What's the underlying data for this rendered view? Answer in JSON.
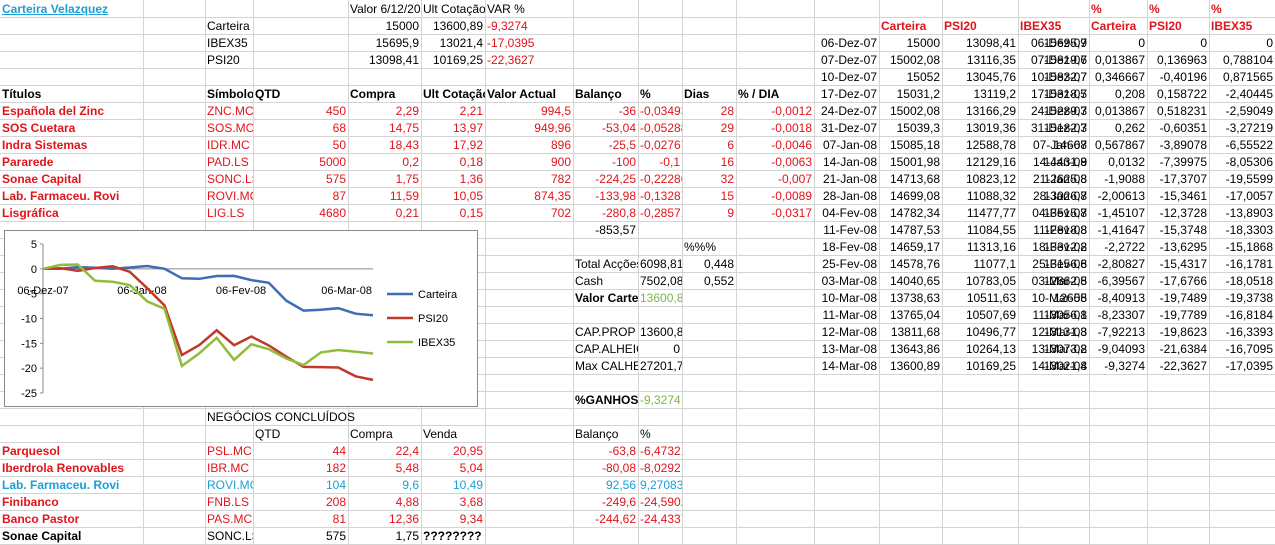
{
  "colors": {
    "red": "#e0141b",
    "blue": "#1b9fd6",
    "green": "#7ab648",
    "grid": "#d4d4d4",
    "carteira_line": "#3e6db5",
    "psi20_line": "#c0392b",
    "ibex35_line": "#8fbc3b"
  },
  "title_link": "Carteira Velazquez",
  "summary": {
    "header": [
      "Valor 6/12/2007",
      "Ult Cotação",
      "VAR %"
    ],
    "rows": [
      {
        "label": "Carteira",
        "valor": "15000",
        "ult": "13600,89",
        "var": "-9,3274"
      },
      {
        "label": "IBEX35",
        "valor": "15695,9",
        "ult": "13021,4",
        "var": "-17,0395"
      },
      {
        "label": "PSI20",
        "valor": "13098,41",
        "ult": "10169,25",
        "var": "-22,3627"
      }
    ]
  },
  "holdings": {
    "headers": [
      "Títulos",
      "Símbolo",
      "QTD",
      "Compra",
      "Ult Cotação",
      "Valor Actual",
      "Balanço",
      "%",
      "Dias",
      "% / DIA"
    ],
    "rows": [
      [
        "Española del Zinc",
        "ZNC.MC",
        "450",
        "2,29",
        "2,21",
        "994,5",
        "-36",
        "-0,03493",
        "28",
        "-0,0012"
      ],
      [
        "SOS Cuetara",
        "SOS.MC",
        "68",
        "14,75",
        "13,97",
        "949,96",
        "-53,04",
        "-0,05288",
        "29",
        "-0,0018"
      ],
      [
        "Indra Sistemas",
        "IDR.MC",
        "50",
        "18,43",
        "17,92",
        "896",
        "-25,5",
        "-0,02767",
        "6",
        "-0,0046"
      ],
      [
        "Pararede",
        "PAD.LS",
        "5000",
        "0,2",
        "0,18",
        "900",
        "-100",
        "-0,1",
        "16",
        "-0,0063"
      ],
      [
        "Sonae Capital",
        "SONC.LS",
        "575",
        "1,75",
        "1,36",
        "782",
        "-224,25",
        "-0,22286",
        "32",
        "-0,007"
      ],
      [
        "Lab. Farmaceu. Rovi",
        "ROVI.MC",
        "87",
        "11,59",
        "10,05",
        "874,35",
        "-133,98",
        "-0,13287",
        "15",
        "-0,0089"
      ],
      [
        "Lisgráfica",
        "LIG.LS",
        "4680",
        "0,21",
        "0,15",
        "702",
        "-280,8",
        "-0,28571",
        "9",
        "-0,0317"
      ]
    ],
    "total_balanco": "-853,57"
  },
  "totals": {
    "pct_header": "%%%",
    "rows": [
      {
        "label": "Total Acções",
        "value": "6098,81",
        "pct": "0,448",
        "bold": false,
        "green": false
      },
      {
        "label": "Cash",
        "value": "7502,08",
        "pct": "0,552",
        "bold": false,
        "green": false
      },
      {
        "label": "Valor Carteira",
        "value": "13600,89",
        "pct": "",
        "bold": true,
        "green": true
      },
      {
        "label": "CAP.PROP",
        "value": "13600,89",
        "pct": "",
        "bold": false,
        "green": false
      },
      {
        "label": "CAP.ALHEIO",
        "value": "0",
        "pct": "",
        "bold": false,
        "green": false
      },
      {
        "label": "Max CALHEIO",
        "value": "27201,78",
        "pct": "",
        "bold": false,
        "green": false
      },
      {
        "label": "%GANHOS",
        "value": "-9,3274",
        "pct": "",
        "bold": true,
        "green": true
      }
    ]
  },
  "closed": {
    "title": "NEGÓCIOS CONCLUÍDOS",
    "headers": [
      "QTD",
      "Compra",
      "Venda",
      "Balanço",
      "%"
    ],
    "rows": [
      {
        "cells": [
          "Parquesol",
          "PSL.MC",
          "44",
          "22,4",
          "20,95",
          "-63,8",
          "-6,47321"
        ],
        "color": "red"
      },
      {
        "cells": [
          "Iberdrola Renovables",
          "IBR.MC",
          "182",
          "5,48",
          "5,04",
          "-80,08",
          "-8,0292"
        ],
        "color": "red"
      },
      {
        "cells": [
          "Lab. Farmaceu. Rovi",
          "ROVI.MC",
          "104",
          "9,6",
          "10,49",
          "92,56",
          "9,270833"
        ],
        "color": "blue"
      },
      {
        "cells": [
          "Finibanco",
          "FNB.LS",
          "208",
          "4,88",
          "3,68",
          "-249,6",
          "-24,5902"
        ],
        "color": "red"
      },
      {
        "cells": [
          "Banco Pastor",
          "PAS.MC",
          "81",
          "12,36",
          "9,34",
          "-244,62",
          "-24,4337"
        ],
        "color": "red"
      },
      {
        "cells": [
          "Sonae Capital",
          "SONC.LS",
          "575",
          "1,75",
          "????????",
          "",
          ""
        ],
        "color": "black"
      }
    ]
  },
  "history": {
    "headers": [
      "Carteira",
      "PSI20",
      "IBEX35"
    ],
    "rows": [
      [
        "06-Dez-07",
        "15000",
        "13098,41",
        "15695,9"
      ],
      [
        "07-Dez-07",
        "15002,08",
        "13116,35",
        "15819,6"
      ],
      [
        "10-Dez-07",
        "15052",
        "13045,76",
        "15832,7"
      ],
      [
        "17-Dez-07",
        "15031,2",
        "13119,2",
        "15318,5"
      ],
      [
        "24-Dez-07",
        "15002,08",
        "13166,29",
        "15289,3"
      ],
      [
        "31-Dez-07",
        "15039,3",
        "13019,36",
        "15182,3"
      ],
      [
        "07-Jan-08",
        "15085,18",
        "12588,78",
        "14667"
      ],
      [
        "14-Jan-08",
        "15001,98",
        "12129,16",
        "14431,9"
      ],
      [
        "21-Jan-08",
        "14713,68",
        "10823,12",
        "12625,8"
      ],
      [
        "28-Jan-08",
        "14699,08",
        "11088,32",
        "13026,7"
      ],
      [
        "04-Fev-08",
        "14782,34",
        "11477,77",
        "13515,7"
      ],
      [
        "11-Fev-08",
        "14787,53",
        "11084,55",
        "12818,8"
      ],
      [
        "18-Fev-08",
        "14659,17",
        "11313,16",
        "13312,2"
      ],
      [
        "25-Fev-08",
        "14578,76",
        "11077,1",
        "13156,6"
      ],
      [
        "03-Mar-08",
        "14040,65",
        "10783,05",
        "12862,5"
      ],
      [
        "10-Mar-08",
        "13738,63",
        "10511,63",
        "12655"
      ],
      [
        "11-Mar-08",
        "13765,04",
        "10507,69",
        "13056,1"
      ],
      [
        "12-Mar-08",
        "13811,68",
        "10496,77",
        "13131,3"
      ],
      [
        "13-Mar-08",
        "13643,86",
        "10264,13",
        "13073,2"
      ],
      [
        "14-Mar-08",
        "13600,89",
        "10169,25",
        "13021,4"
      ]
    ]
  },
  "pct_history": {
    "headers_top": [
      "%",
      "%",
      "%"
    ],
    "headers": [
      "Carteira",
      "PSI20",
      "IBEX35"
    ],
    "rows": [
      [
        "06-Dez-07",
        "0",
        "0",
        "0"
      ],
      [
        "07-Dez-07",
        "0,013867",
        "0,136963",
        "0,788104"
      ],
      [
        "10-Dez-07",
        "0,346667",
        "-0,40196",
        "0,871565"
      ],
      [
        "17-Dez-07",
        "0,208",
        "0,158722",
        "-2,40445"
      ],
      [
        "24-Dez-07",
        "0,013867",
        "0,518231",
        "-2,59049"
      ],
      [
        "31-Dez-07",
        "0,262",
        "-0,60351",
        "-3,27219"
      ],
      [
        "07-Jan-08",
        "0,567867",
        "-3,89078",
        "-6,55522"
      ],
      [
        "14-Jan-08",
        "0,0132",
        "-7,39975",
        "-8,05306"
      ],
      [
        "21-Jan-08",
        "-1,9088",
        "-17,3707",
        "-19,5599"
      ],
      [
        "28-Jan-08",
        "-2,00613",
        "-15,3461",
        "-17,0057"
      ],
      [
        "04-Fev-08",
        "-1,45107",
        "-12,3728",
        "-13,8903"
      ],
      [
        "11-Fev-08",
        "-1,41647",
        "-15,3748",
        "-18,3303"
      ],
      [
        "18-Fev-08",
        "-2,2722",
        "-13,6295",
        "-15,1868"
      ],
      [
        "25-Fev-08",
        "-2,80827",
        "-15,4317",
        "-16,1781"
      ],
      [
        "03-Mar-08",
        "-6,39567",
        "-17,6766",
        "-18,0518"
      ],
      [
        "10-Mar-08",
        "-8,40913",
        "-19,7489",
        "-19,3738"
      ],
      [
        "11-Mar-08",
        "-8,23307",
        "-19,7789",
        "-16,8184"
      ],
      [
        "12-Mar-08",
        "-7,92213",
        "-19,8623",
        "-16,3393"
      ],
      [
        "13-Mar-08",
        "-9,04093",
        "-21,6384",
        "-16,7095"
      ],
      [
        "14-Mar-08",
        "-9,3274",
        "-22,3627",
        "-17,0395"
      ]
    ]
  },
  "chart_data": {
    "type": "line",
    "x": [
      "06-Dez-07",
      "07-Dez-07",
      "10-Dez-07",
      "17-Dez-07",
      "24-Dez-07",
      "31-Dez-07",
      "07-Jan-08",
      "14-Jan-08",
      "21-Jan-08",
      "28-Jan-08",
      "04-Fev-08",
      "11-Fev-08",
      "18-Fev-08",
      "25-Fev-08",
      "03-Mar-08",
      "10-Mar-08",
      "11-Mar-08",
      "12-Mar-08",
      "13-Mar-08",
      "14-Mar-08"
    ],
    "x_tick_labels": [
      "06-Dez-07",
      "06-Jan-08",
      "06-Fev-08",
      "06-Mar-08"
    ],
    "y_ticks": [
      5,
      0,
      -5,
      -10,
      -15,
      -20,
      -25
    ],
    "ylim": [
      -25,
      5
    ],
    "series": [
      {
        "name": "Carteira",
        "values": [
          0,
          0.013867,
          0.346667,
          0.208,
          0.013867,
          0.262,
          0.567867,
          0.0132,
          -1.9088,
          -2.00613,
          -1.45107,
          -1.41647,
          -2.2722,
          -2.80827,
          -6.39567,
          -8.40913,
          -8.23307,
          -7.92213,
          -9.04093,
          -9.3274
        ]
      },
      {
        "name": "PSI20",
        "values": [
          0,
          0.136963,
          -0.40196,
          0.158722,
          0.518231,
          -0.60351,
          -3.89078,
          -7.39975,
          -17.3707,
          -15.3461,
          -12.3728,
          -15.3748,
          -13.6295,
          -15.4317,
          -17.6766,
          -19.7489,
          -19.7789,
          -19.8623,
          -21.6384,
          -22.3627
        ]
      },
      {
        "name": "IBEX35",
        "values": [
          0,
          0.788104,
          0.871565,
          -2.40445,
          -2.59049,
          -3.27219,
          -6.55522,
          -8.05306,
          -19.5599,
          -17.0057,
          -13.8903,
          -18.3303,
          -15.1868,
          -16.1781,
          -18.0518,
          -19.3738,
          -16.8184,
          -16.3393,
          -16.7095,
          -17.0395
        ]
      }
    ],
    "legend": "right"
  }
}
